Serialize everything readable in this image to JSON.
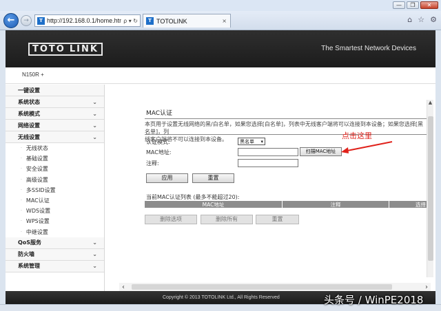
{
  "browser": {
    "url": "http://192.168.0.1/home.htm",
    "address_icons": "ρ ▾ ↻",
    "tab_title": "TOTOLINK",
    "tab_close": "×",
    "favicon_letter": "T",
    "window_buttons": [
      "—",
      "❐",
      "✕"
    ],
    "toolbar_icons": [
      "⌂",
      "☆",
      "⚙"
    ]
  },
  "header": {
    "logo_left": "TOTO",
    "logo_right": "LINK",
    "tagline": "The Smartest Network Devices"
  },
  "model": "N150R +",
  "sidebar": {
    "items": [
      {
        "label": "一键设置",
        "expandable": false
      },
      {
        "label": "系统状态",
        "expandable": true
      },
      {
        "label": "系统模式",
        "expandable": true
      },
      {
        "label": "网络设置",
        "expandable": true
      },
      {
        "label": "无线设置",
        "expandable": true
      }
    ],
    "wireless_sub": [
      "无线状态",
      "基础设置",
      "安全设置",
      "高级设置",
      "多SSID设置",
      "MAC认证",
      "WDS设置",
      "WPS设置",
      "中继设置"
    ],
    "bottom_items": [
      {
        "label": "QoS服务",
        "expandable": true
      },
      {
        "label": "防火墙",
        "expandable": true
      },
      {
        "label": "系统管理",
        "expandable": true
      }
    ]
  },
  "mac_auth": {
    "title": "MAC认证",
    "description_line1": "本页用于设置无线网络的黑/白名单，如果您选择[白名单]，列表中无线客户端将可以连接到本设备；如果您选择[黑名单]，列",
    "description_line2": "线客户端将不可以连接到本设备。",
    "mode_label": "认证模式:",
    "mode_value": "黑名单",
    "mac_label": "MAC地址:",
    "mac_value": "",
    "note_label": "注释:",
    "note_value": "",
    "scan_button": "扫描MAC地址",
    "annotation": "点击这里",
    "apply_button": "应用",
    "reset_button": "重置",
    "list_title": "当前MAC认证列表 (最多不能超过20):",
    "columns": [
      "MAC地址",
      "注释",
      "选择"
    ],
    "delete_selected": "删除选项",
    "delete_all": "删除所有",
    "list_reset": "重置"
  },
  "footer": {
    "copyright": "Copyright © 2013 TOTOLINK Ltd.,  All Rights Reserved"
  },
  "watermark": "头条号 / WinPE2018",
  "colors": {
    "header_bg": "#1c1c1c",
    "annotation": "#e0221b",
    "table_header": "#8c8c8c"
  }
}
